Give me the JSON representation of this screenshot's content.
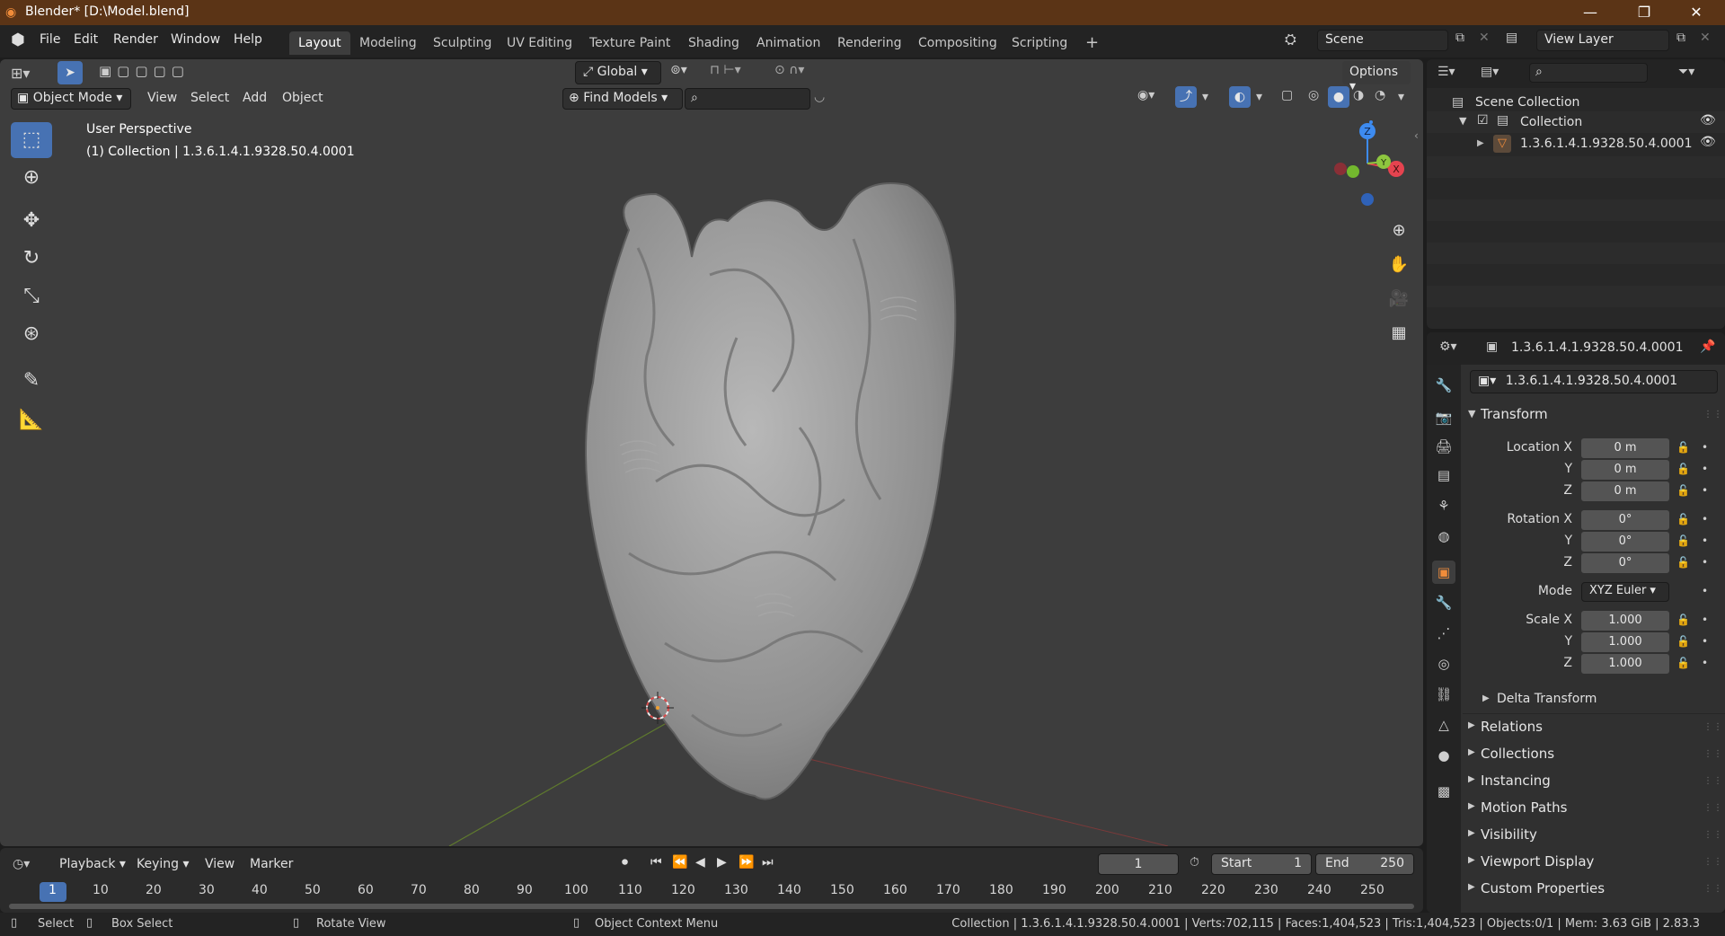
{
  "window": {
    "title": "Blender* [D:\\Model.blend]",
    "controls": [
      "—",
      "❐",
      "✕"
    ]
  },
  "menu": [
    "File",
    "Edit",
    "Render",
    "Window",
    "Help"
  ],
  "workspaces": [
    "Layout",
    "Modeling",
    "Sculpting",
    "UV Editing",
    "Texture Paint",
    "Shading",
    "Animation",
    "Rendering",
    "Compositing",
    "Scripting"
  ],
  "add_workspace": "+",
  "scene": {
    "label": "Scene"
  },
  "view_layer": {
    "label": "View Layer"
  },
  "viewport": {
    "orientation": "Global",
    "options": "Options",
    "mode": "Object Mode",
    "header_menus": [
      "View",
      "Select",
      "Add",
      "Object"
    ],
    "find_models": "Find Models",
    "hud_line1": "User Perspective",
    "hud_line2": "(1) Collection | 1.3.6.1.4.1.9328.50.4.0001",
    "gizmo": {
      "x": "X",
      "y": "Y",
      "z": "Z"
    }
  },
  "timeline": {
    "menus": [
      "Playback",
      "Keying",
      "View",
      "Marker"
    ],
    "current_frame": "1",
    "start_label": "Start",
    "start": "1",
    "end_label": "End",
    "end": "250",
    "ticks": [
      "1",
      "10",
      "20",
      "30",
      "40",
      "50",
      "60",
      "70",
      "80",
      "90",
      "100",
      "110",
      "120",
      "130",
      "140",
      "150",
      "160",
      "170",
      "180",
      "190",
      "200",
      "210",
      "220",
      "230",
      "240",
      "250"
    ]
  },
  "statusbar": {
    "select": "Select",
    "box_select": "Box Select",
    "rotate_view": "Rotate View",
    "context_menu": "Object Context Menu",
    "stats": "Collection | 1.3.6.1.4.1.9328.50.4.0001 | Verts:702,115 | Faces:1,404,523 | Tris:1,404,523 | Objects:0/1 | Mem: 3.63 GiB | 2.83.3"
  },
  "outliner": {
    "scene_collection": "Scene Collection",
    "collection": "Collection",
    "object": "1.3.6.1.4.1.9328.50.4.0001"
  },
  "properties": {
    "header_object": "1.3.6.1.4.1.9328.50.4.0001",
    "object_name": "1.3.6.1.4.1.9328.50.4.0001",
    "transform": "Transform",
    "location_x_label": "Location X",
    "y_label": "Y",
    "z_label": "Z",
    "location": [
      "0 m",
      "0 m",
      "0 m"
    ],
    "rotation_x_label": "Rotation X",
    "rotation": [
      "0°",
      "0°",
      "0°"
    ],
    "mode_label": "Mode",
    "mode": "XYZ Euler",
    "scale_x_label": "Scale X",
    "scale": [
      "1.000",
      "1.000",
      "1.000"
    ],
    "delta_transform": "Delta Transform",
    "sections": [
      "Relations",
      "Collections",
      "Instancing",
      "Motion Paths",
      "Visibility",
      "Viewport Display",
      "Custom Properties"
    ]
  },
  "colors": {
    "accent": "#4772b3",
    "titlebar": "#5b3416",
    "object_orange": "#f08c3a",
    "axis_x": "#e5434f",
    "axis_y": "#8ec63f",
    "axis_z": "#3d8bf0"
  }
}
